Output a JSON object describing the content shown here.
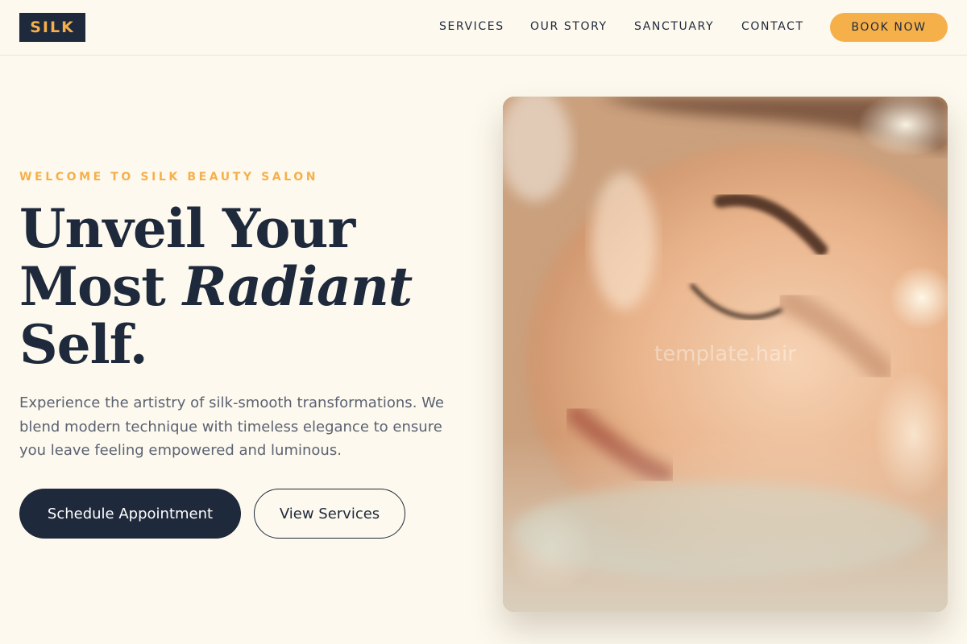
{
  "brand": {
    "logo": "SILK"
  },
  "nav": {
    "items": [
      {
        "label": "SERVICES"
      },
      {
        "label": "OUR STORY"
      },
      {
        "label": "SANCTUARY"
      },
      {
        "label": "CONTACT"
      }
    ],
    "cta_label": "BOOK NOW"
  },
  "hero": {
    "eyebrow": "WELCOME TO SILK BEAUTY SALON",
    "headline": {
      "line1": "Unveil Your",
      "line2_plain": "Most ",
      "line2_italic": "Radiant",
      "line3": "Self."
    },
    "lede": "Experience the artistry of silk-smooth transformations. We blend modern technique with timeless elegance to ensure you leave feeling empowered and luminous.",
    "primary_button": "Schedule Appointment",
    "secondary_button": "View Services",
    "image": {
      "watermark": "template.hair"
    }
  },
  "colors": {
    "background": "#fdf9ee",
    "navy": "#1e293b",
    "accent": "#f6b04a",
    "body_text": "#5b6272"
  }
}
